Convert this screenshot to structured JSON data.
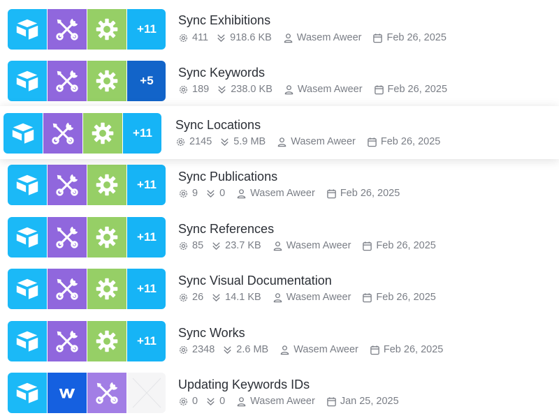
{
  "colors": {
    "airtable_blue": "#1bb9f7",
    "tools_purple": "#9067dd",
    "settings_green": "#96cf66",
    "more_badge_blue": "#16b4f6",
    "more_badge_dark": "#1264c9",
    "webflow_blue": "#1560e0"
  },
  "scenarios": [
    {
      "title": "Sync Exhibitions",
      "more": "+11",
      "operations": "411",
      "data_transfer": "918.6 KB",
      "author": "Wasem Aweer",
      "date": "Feb 26, 2025"
    },
    {
      "title": "Sync Keywords",
      "more": "+5",
      "operations": "189",
      "data_transfer": "238.0 KB",
      "author": "Wasem Aweer",
      "date": "Feb 26, 2025"
    },
    {
      "title": "Sync Locations",
      "more": "+11",
      "operations": "2145",
      "data_transfer": "5.9 MB",
      "author": "Wasem Aweer",
      "date": "Feb 26, 2025"
    },
    {
      "title": "Sync Publications",
      "more": "+11",
      "operations": "9",
      "data_transfer": "0",
      "author": "Wasem Aweer",
      "date": "Feb 26, 2025"
    },
    {
      "title": "Sync References",
      "more": "+11",
      "operations": "85",
      "data_transfer": "23.7 KB",
      "author": "Wasem Aweer",
      "date": "Feb 26, 2025"
    },
    {
      "title": "Sync Visual Documentation",
      "more": "+11",
      "operations": "26",
      "data_transfer": "14.1 KB",
      "author": "Wasem Aweer",
      "date": "Feb 26, 2025"
    },
    {
      "title": "Sync Works",
      "more": "+11",
      "operations": "2348",
      "data_transfer": "2.6 MB",
      "author": "Wasem Aweer",
      "date": "Feb 26, 2025"
    },
    {
      "title": "Updating Keywords IDs",
      "operations": "0",
      "data_transfer": "0",
      "author": "Wasem Aweer",
      "date": "Jan 25, 2025"
    }
  ]
}
